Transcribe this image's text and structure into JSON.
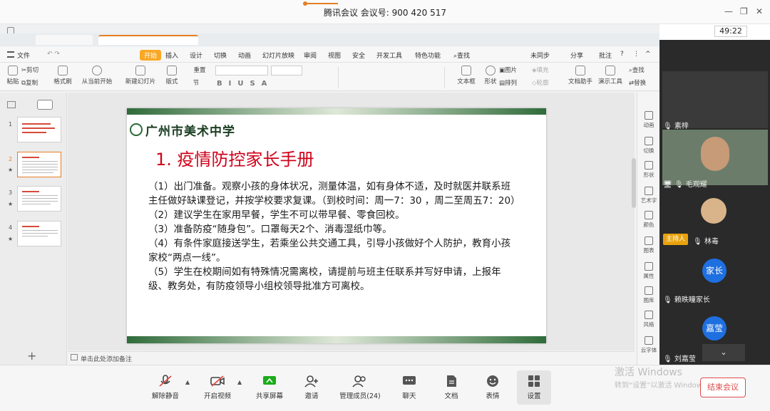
{
  "meeting": {
    "title": "腾讯会议  会议号: 900 420 517",
    "timer": "49:22"
  },
  "wps": {
    "menu": [
      "文件",
      "开始",
      "插入",
      "设计",
      "切换",
      "动画",
      "幻灯片放映",
      "审阅",
      "视图",
      "安全",
      "开发工具",
      "特色功能",
      "查找"
    ],
    "menu_right": [
      "未同步",
      "分享",
      "批注"
    ],
    "toolbar": [
      "粘贴",
      "剪切",
      "复制",
      "格式刷",
      "从当前开始",
      "新建幻灯片",
      "版式",
      "节",
      "重置",
      "文本框",
      "形状",
      "图片",
      "排列",
      "填充",
      "轮廓",
      "文档助手",
      "演示工具",
      "查找",
      "替换"
    ],
    "right_rail": [
      "动画",
      "切换",
      "形状",
      "艺术字",
      "颜色",
      "图表",
      "属性",
      "图库",
      "风格",
      "云字体"
    ],
    "notes_placeholder": "单击此处添加备注",
    "slide_numbers": [
      "1",
      "2",
      "3",
      "4"
    ]
  },
  "slide": {
    "school": "广州市美术中学",
    "title": "1. 疫情防控家长手册",
    "paragraphs": [
      "（1）出门准备。观察小孩的身体状况，测量体温，如有身体不适，及时就医并联系班主任做好缺课登记，并按学校要求复课。（到校时间：周一7：30 ，周二至周五7：20）",
      "（2）建议学生在家用早餐，学生不可以带早餐、零食回校。",
      "（3）准备防疫“随身包”。口罩每天2个、消毒湿纸巾等。",
      "（4）有条件家庭接送学生，若乘坐公共交通工具，引导小孩做好个人防护，教育小孩家校“两点一线”。",
      "（5）学生在校期间如有特殊情况需离校，请提前与班主任联系并写好申请，上报年级、教务处，有防疫领导小组校领导批准方可离校。"
    ]
  },
  "participants": [
    {
      "name": "素梓"
    },
    {
      "name": "毛观耀"
    },
    {
      "name": "林毒",
      "role": "主持人"
    },
    {
      "name": "赖昳瞳家长",
      "avatar": "家长"
    },
    {
      "name": "刘嘉莹",
      "avatar": "嘉莹"
    }
  ],
  "controls": [
    "解除静音",
    "开启视频",
    "共享屏幕",
    "邀请",
    "管理成员(24)",
    "聊天",
    "文档",
    "表情",
    "设置"
  ],
  "end_button": "结束会议",
  "watermark": {
    "line1": "激活 Windows",
    "line2": "转到“设置”以激活 Windows。"
  },
  "colors": {
    "accent": "#f9a825",
    "slide_title": "#d0021b",
    "end": "#e04a4a",
    "avatar": "#1e6fe0"
  }
}
